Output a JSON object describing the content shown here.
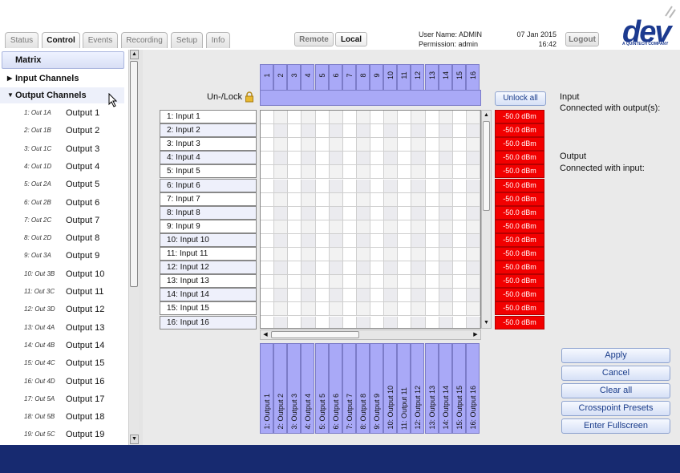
{
  "tabs": [
    {
      "label": "Status"
    },
    {
      "label": "Control"
    },
    {
      "label": "Events"
    },
    {
      "label": "Recording"
    },
    {
      "label": "Setup"
    },
    {
      "label": "Info"
    }
  ],
  "mode": {
    "remote": "Remote",
    "local": "Local"
  },
  "user": {
    "name_line": "User Name: ADMIN",
    "perm_line": "Permission: admin"
  },
  "datetime": {
    "date": "07 Jan 2015",
    "time": "16:42"
  },
  "logout": "Logout",
  "logo": {
    "text": "dev",
    "tagline": "A QUINTECH COMPANY"
  },
  "sidebar": {
    "matrix": "Matrix",
    "input_group": "Input Channels",
    "output_group": "Output Channels",
    "outputs": [
      {
        "code": "1:  Out 1A",
        "name": "Output 1"
      },
      {
        "code": "2:  Out 1B",
        "name": "Output 2"
      },
      {
        "code": "3:  Out 1C",
        "name": "Output 3"
      },
      {
        "code": "4:  Out 1D",
        "name": "Output 4"
      },
      {
        "code": "5:  Out 2A",
        "name": "Output 5"
      },
      {
        "code": "6:  Out 2B",
        "name": "Output 6"
      },
      {
        "code": "7:  Out 2C",
        "name": "Output 7"
      },
      {
        "code": "8:  Out 2D",
        "name": "Output 8"
      },
      {
        "code": "9:  Out 3A",
        "name": "Output 9"
      },
      {
        "code": "10: Out 3B",
        "name": "Output 10"
      },
      {
        "code": "11: Out 3C",
        "name": "Output 11"
      },
      {
        "code": "12: Out 3D",
        "name": "Output 12"
      },
      {
        "code": "13: Out 4A",
        "name": "Output 13"
      },
      {
        "code": "14: Out 4B",
        "name": "Output 14"
      },
      {
        "code": "15: Out 4C",
        "name": "Output 15"
      },
      {
        "code": "16: Out 4D",
        "name": "Output 16"
      },
      {
        "code": "17: Out 5A",
        "name": "Output 17"
      },
      {
        "code": "18: Out 5B",
        "name": "Output 18"
      },
      {
        "code": "19: Out 5C",
        "name": "Output 19"
      }
    ]
  },
  "matrix": {
    "unlock_label": "Un-/Lock",
    "unlock_all": "Unlock all",
    "col_numbers": [
      "1",
      "2",
      "3",
      "4",
      "5",
      "6",
      "7",
      "8",
      "9",
      "10",
      "11",
      "12",
      "13",
      "14",
      "15",
      "16"
    ],
    "inputs": [
      "1: Input 1",
      "2: Input 2",
      "3: Input 3",
      "4: Input 4",
      "5: Input 5",
      "6: Input 6",
      "7: Input 7",
      "8: Input 8",
      "9: Input 9",
      "10: Input 10",
      "11: Input 11",
      "12: Input 12",
      "13: Input 13",
      "14: Input 14",
      "15: Input 15",
      "16: Input 16"
    ],
    "outputs": [
      "1: Output 1",
      "2: Output 2",
      "3: Output 3",
      "4: Output 4",
      "5: Output 5",
      "6: Output 6",
      "7: Output 7",
      "8: Output 8",
      "9: Output 9",
      "10: Output 10",
      "11: Output 11",
      "12: Output 12",
      "13: Output 13",
      "14: Output 14",
      "15: Output 15",
      "16: Output 16"
    ],
    "levels": [
      "-50.0 dBm",
      "-50.0 dBm",
      "-50.0 dBm",
      "-50.0 dBm",
      "-50.0 dBm",
      "-50.0 dBm",
      "-50.0 dBm",
      "-50.0 dBm",
      "-50.0 dBm",
      "-50.0 dBm",
      "-50.0 dBm",
      "-50.0 dBm",
      "-50.0 dBm",
      "-50.0 dBm",
      "-50.0 dBm",
      "-50.0 dBm"
    ]
  },
  "info": {
    "input_title": "Input",
    "input_sub": "Connected with output(s):",
    "output_title": "Output",
    "output_sub": "Connected with input:"
  },
  "actions": [
    "Apply",
    "Cancel",
    "Clear all",
    "Crosspoint Presets",
    "Enter Fullscreen"
  ],
  "colors": {
    "accent": "#a9a9f7",
    "level_red": "#f20000",
    "footer": "#172a70",
    "brand": "#1c3a8f"
  }
}
